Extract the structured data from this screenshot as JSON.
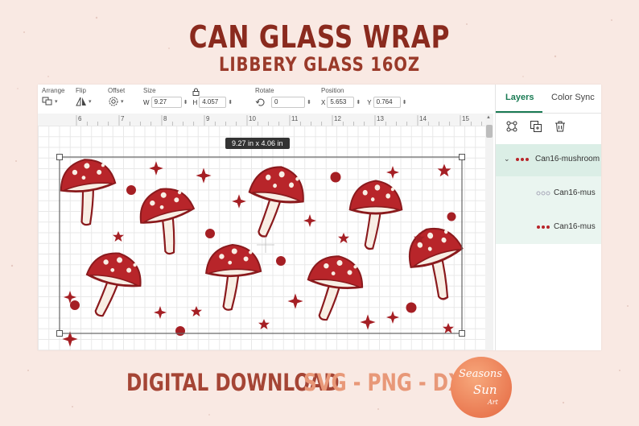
{
  "heading": {
    "title": "CAN GLASS WRAP",
    "subtitle": "LIBBERY GLASS 16OZ"
  },
  "toolbar": {
    "arrange_label": "Arrange",
    "flip_label": "Flip",
    "offset_label": "Offset",
    "size_label": "Size",
    "width_prefix": "W",
    "width_value": "9.27",
    "height_prefix": "H",
    "height_value": "4.057",
    "rotate_label": "Rotate",
    "rotate_value": "0",
    "position_label": "Position",
    "x_prefix": "X",
    "x_value": "5.653",
    "y_prefix": "Y",
    "y_value": "0.764"
  },
  "ruler": {
    "ticks": [
      "6",
      "7",
      "8",
      "9",
      "10",
      "11",
      "12",
      "13",
      "14",
      "15"
    ]
  },
  "canvas": {
    "size_tooltip": "9.27  in x 4.06  in"
  },
  "sidebar": {
    "tabs": [
      {
        "label": "Layers",
        "active": true
      },
      {
        "label": "Color Sync",
        "active": false
      }
    ],
    "layers": [
      {
        "label": "Can16-mushroom",
        "type": "group"
      },
      {
        "label": "Can16-mus",
        "type": "layer"
      },
      {
        "label": "Can16-mus",
        "type": "layer"
      }
    ]
  },
  "footer": {
    "digital_download": "DIGITAL DOWNLOAD",
    "formats": "SVG - PNG - DXF"
  },
  "logo": {
    "line1": "Seasons",
    "line2": "Sun",
    "line3": "Art"
  },
  "colors": {
    "title": "#8a2a1e",
    "accent_green": "#1a7b54",
    "mushroom_red": "#b8252a",
    "mushroom_cream": "#f8eee4",
    "logo_orange": "#ea7a52",
    "formats_peach": "#e89878"
  }
}
